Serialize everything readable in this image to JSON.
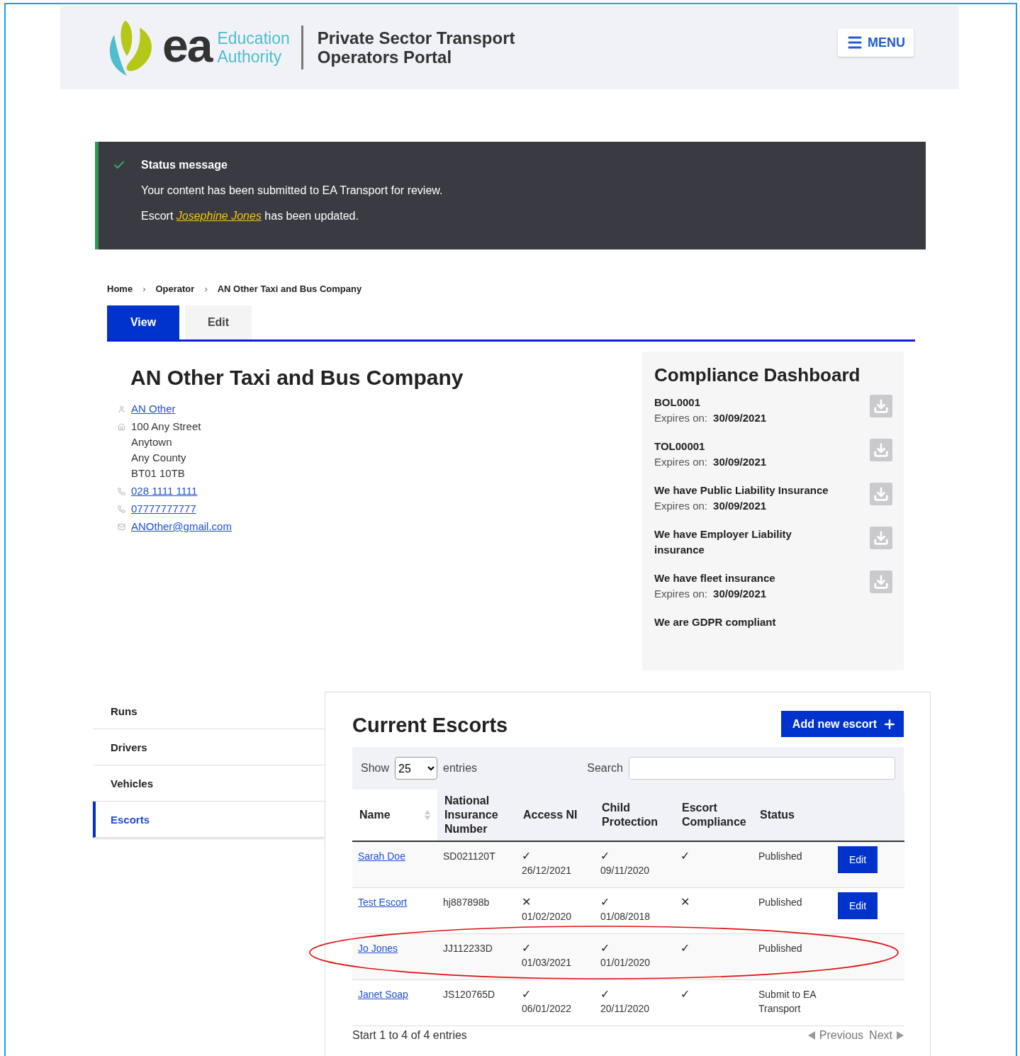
{
  "header": {
    "logo": {
      "mark": "ea",
      "name": [
        "Education",
        "Authority"
      ]
    },
    "title": [
      "Private Sector Transport",
      "Operators Portal"
    ],
    "menu_button": "MENU"
  },
  "status_message": {
    "title": "Status message",
    "lines": [
      {
        "prefix": "Your content has been submitted to EA Transport for review."
      },
      {
        "prefix": "Escort ",
        "link": "Josephine Jones",
        "suffix": " has been updated."
      }
    ]
  },
  "breadcrumb": {
    "separator": "›",
    "items": [
      "Home",
      "Operator",
      "AN Other Taxi and Bus Company"
    ]
  },
  "tabs": [
    {
      "label": "View",
      "selected": true
    },
    {
      "label": "Edit",
      "selected": false
    }
  ],
  "operator": {
    "name": "AN Other Taxi and Bus Company",
    "contacts": [
      {
        "kind": "person",
        "lines": [
          "AN Other"
        ]
      },
      {
        "kind": "address",
        "lines": [
          "100 Any Street",
          "Anytown",
          "Any County",
          "BT01 10TB"
        ]
      },
      {
        "kind": "phone",
        "lines": [
          "028 1111 1111"
        ]
      },
      {
        "kind": "phone",
        "lines": [
          "07777777777"
        ]
      },
      {
        "kind": "email",
        "lines": [
          "ANOther@gmail.com"
        ]
      }
    ]
  },
  "compliance": {
    "title": "Compliance Dashboard",
    "items": [
      {
        "name": "BOL0001",
        "expires_label": "Expires on:",
        "expires": "30/09/2021",
        "download": true
      },
      {
        "name": "TOL00001",
        "expires_label": "Expires on:",
        "expires": "30/09/2021",
        "download": true
      },
      {
        "name": "We have Public Liability Insurance",
        "expires_label": "Expires on:",
        "expires": "30/09/2021",
        "download": true
      },
      {
        "name": "We have Employer Liability insurance",
        "download": true
      },
      {
        "name": "We have fleet insurance",
        "expires_label": "Expires on:",
        "expires": "30/09/2021",
        "download": true
      },
      {
        "name": "We are GDPR compliant",
        "download": false
      }
    ]
  },
  "side_menu": [
    {
      "label": "Runs",
      "selected": false
    },
    {
      "label": "Drivers",
      "selected": false
    },
    {
      "label": "Vehicles",
      "selected": false
    },
    {
      "label": "Escorts",
      "selected": true
    }
  ],
  "escorts": {
    "title": "Current Escorts",
    "add_button": "Add new escort",
    "length": {
      "before": "Show",
      "value": "25",
      "after": "entries"
    },
    "search_label": "Search",
    "columns": [
      {
        "label": "Name",
        "sortable": true
      },
      {
        "label": "National Insurance Number",
        "sortable": false
      },
      {
        "label": "Access NI",
        "sortable": false
      },
      {
        "label": "Child Protection",
        "sortable": false
      },
      {
        "label": "Escort Compliance",
        "sortable": false
      },
      {
        "label": "Status",
        "sortable": false
      }
    ],
    "rows": [
      {
        "name": "Sarah Doe",
        "ni": "SD021120T",
        "access_ni": {
          "mark": "✓",
          "date": "26/12/2021"
        },
        "child_protection": {
          "mark": "✓",
          "date": "09/11/2020"
        },
        "escort_compliance": "✓",
        "status": "Published",
        "action": "Edit",
        "circled": false
      },
      {
        "name": "Test Escort",
        "ni": "hj887898b",
        "access_ni": {
          "mark": "✕",
          "date": "01/02/2020"
        },
        "child_protection": {
          "mark": "✓",
          "date": "01/08/2018"
        },
        "escort_compliance": "✕",
        "status": "Published",
        "action": "Edit",
        "circled": false
      },
      {
        "name": "Jo Jones",
        "ni": "JJ112233D",
        "access_ni": {
          "mark": "✓",
          "date": "01/03/2021"
        },
        "child_protection": {
          "mark": "✓",
          "date": "01/01/2020"
        },
        "escort_compliance": "✓",
        "status": "Published",
        "circled": true
      },
      {
        "name": "Janet Soap",
        "ni": "JS120765D",
        "access_ni": {
          "mark": "✓",
          "date": "06/01/2022"
        },
        "child_protection": {
          "mark": "✓",
          "date": "20/11/2020"
        },
        "escort_compliance": "✓",
        "status": "Submit to EA Transport",
        "circled": false
      }
    ],
    "info": "Start 1 to 4 of 4 entries",
    "pager": {
      "previous": "Previous",
      "next": "Next"
    }
  }
}
